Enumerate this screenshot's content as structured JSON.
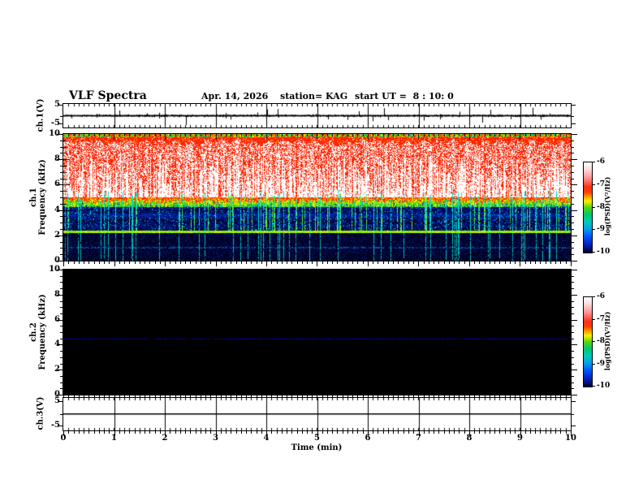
{
  "header": {
    "title": "VLF Spectra",
    "date": "Apr. 14, 2026",
    "station": "station= KAG",
    "start_ut": "start UT =  8 : 10: 0"
  },
  "x_axis": {
    "label": "Time (min)",
    "min": 0,
    "max": 10,
    "major_ticks": [
      0,
      1,
      2,
      3,
      4,
      5,
      6,
      7,
      8,
      9,
      10
    ],
    "minor_step": 0.1
  },
  "panels": {
    "ch1_wave": {
      "ylabel": "ch.1(V)",
      "ytick_values": [
        5,
        -5
      ],
      "ytick_labels": [
        "5",
        "-5"
      ],
      "ylim": [
        -6.5,
        6.5
      ]
    },
    "ch1_spec": {
      "ylabel_line1": "ch.1",
      "ylabel_line2": "Frequency (kHz)",
      "ytick_values": [
        10,
        8,
        6,
        4,
        2,
        0
      ],
      "ylim": [
        0,
        10
      ],
      "yminor_step": 0.5
    },
    "ch2_spec": {
      "ylabel_line1": "ch.2",
      "ylabel_line2": "Frequency (kHz)",
      "ytick_values": [
        10,
        8,
        6,
        4,
        2,
        0
      ],
      "ylim": [
        0,
        10
      ],
      "yminor_step": 0.5
    },
    "ch3_wave": {
      "ylabel": "ch.3(V)",
      "ytick_values": [
        5,
        -5
      ],
      "ytick_labels": [
        "5",
        "-5"
      ],
      "ylim": [
        -6.5,
        6.5
      ]
    }
  },
  "colorbar": {
    "label": "log(PSD)(V²/Hz)",
    "tick_values": [
      -6,
      -7,
      -8,
      -9,
      -10
    ],
    "tick_labels": [
      "-6",
      "-7",
      "-8",
      "-9",
      "-10"
    ],
    "gradient": [
      {
        "pos": 0.0,
        "color": "#ffffff"
      },
      {
        "pos": 0.08,
        "color": "#ffd8d8"
      },
      {
        "pos": 0.18,
        "color": "#ff8c8c"
      },
      {
        "pos": 0.27,
        "color": "#ff3018"
      },
      {
        "pos": 0.33,
        "color": "#ff4000"
      },
      {
        "pos": 0.38,
        "color": "#ff9900"
      },
      {
        "pos": 0.43,
        "color": "#ffee00"
      },
      {
        "pos": 0.5,
        "color": "#55d411"
      },
      {
        "pos": 0.58,
        "color": "#00c86e"
      },
      {
        "pos": 0.66,
        "color": "#00c8be"
      },
      {
        "pos": 0.74,
        "color": "#00a0e6"
      },
      {
        "pos": 0.82,
        "color": "#0055ff"
      },
      {
        "pos": 0.91,
        "color": "#0022bb"
      },
      {
        "pos": 1.0,
        "color": "#000033"
      }
    ]
  },
  "palette": {
    "red": "#ff2200",
    "orange": "#ff8800",
    "yellow": "#ffee00",
    "green": "#33cc11",
    "bright_green": "#88ee00",
    "cyan": "#00ddcc",
    "blue": "#0022aa",
    "bright_blue": "#0044dd",
    "navy": "#000033",
    "dark": "#000022",
    "white": "#ffffff",
    "ch2_line_blue": "#0000bb",
    "black": "#000000"
  },
  "chart_data": [
    {
      "type": "line",
      "name": "ch.1 voltage waveform",
      "ylabel": "ch.1(V)",
      "ylim": [
        -6.5,
        6.5
      ],
      "yticks": [
        5,
        -5
      ],
      "baseline": 0,
      "noise_amplitude": 0.5,
      "spikes": [
        {
          "t": 1.1,
          "a": 2.6
        },
        {
          "t": 2.0,
          "a": -2.0
        },
        {
          "t": 2.42,
          "a": -4.6
        },
        {
          "t": 3.3,
          "a": -1.9
        },
        {
          "t": 4.02,
          "a": 3.1
        },
        {
          "t": 4.22,
          "a": 3.3
        },
        {
          "t": 5.22,
          "a": -1.8
        },
        {
          "t": 5.6,
          "a": -2.1
        },
        {
          "t": 5.82,
          "a": 2.2
        },
        {
          "t": 6.1,
          "a": -2.7
        },
        {
          "t": 6.32,
          "a": 3.7
        },
        {
          "t": 6.4,
          "a": -2.2
        },
        {
          "t": 7.1,
          "a": -2.4
        },
        {
          "t": 7.42,
          "a": -1.8
        },
        {
          "t": 7.8,
          "a": 2.0
        },
        {
          "t": 8.25,
          "a": -3.4
        },
        {
          "t": 8.42,
          "a": 2.9
        },
        {
          "t": 8.82,
          "a": -1.7
        },
        {
          "t": 9.25,
          "a": 3.9
        },
        {
          "t": 9.4,
          "a": -2.0
        }
      ]
    },
    {
      "type": "heatmap",
      "name": "ch.1 VLF spectrogram",
      "ylabel": "ch.1 Frequency (kHz)",
      "xlim": [
        0,
        10
      ],
      "ylim": [
        0,
        10
      ],
      "intensity_scale": {
        "label": "log(PSD)(V²/Hz)",
        "min": -10,
        "max": -6
      },
      "bands": [
        {
          "f_range": [
            9.75,
            10.0
          ],
          "desc": "multicolor speckled edge line (green/yellow/red/cyan)"
        },
        {
          "f_range": [
            9.3,
            9.75
          ],
          "desc": "solid red band with wavy lower edge"
        },
        {
          "f_range": [
            5.0,
            9.3
          ],
          "desc": "white background with dense red vertical streaks of varying depth"
        },
        {
          "f_range": [
            4.2,
            5.0
          ],
          "desc": "dense red-yellow-green transition band"
        },
        {
          "f_range": [
            2.36,
            4.2
          ],
          "desc": "blue field with horizontal banding and many cyan/green vertical sferic lines"
        },
        {
          "f_range": [
            2.16,
            2.36
          ],
          "desc": "bright yellow-green horizontal line at ~2.2 kHz"
        },
        {
          "f_range": [
            0.0,
            2.16
          ],
          "desc": "dark navy region, sparse cyan verticals, faint cyan line near 1.0 kHz"
        }
      ],
      "vertical_line_fraction": 0.09,
      "half_line_fraction": 0.12
    },
    {
      "type": "heatmap",
      "name": "ch.2 VLF spectrogram",
      "ylabel": "ch.2 Frequency (kHz)",
      "xlim": [
        0,
        10
      ],
      "ylim": [
        0,
        10
      ],
      "intensity_scale": {
        "label": "log(PSD)(V²/Hz)",
        "min": -10,
        "max": -6
      },
      "bands": [
        {
          "f_range": [
            0.0,
            10.0
          ],
          "desc": "black background (no signal)"
        },
        {
          "f_range": [
            4.45,
            4.55
          ],
          "desc": "thin dark-blue horizontal line at ~4.5 kHz, slightly broken on left half"
        }
      ]
    },
    {
      "type": "line",
      "name": "ch.3 voltage waveform",
      "ylabel": "ch.3(V)",
      "ylim": [
        -6.5,
        6.5
      ],
      "yticks": [
        5,
        -5
      ],
      "baseline": 0,
      "flat": true
    }
  ]
}
